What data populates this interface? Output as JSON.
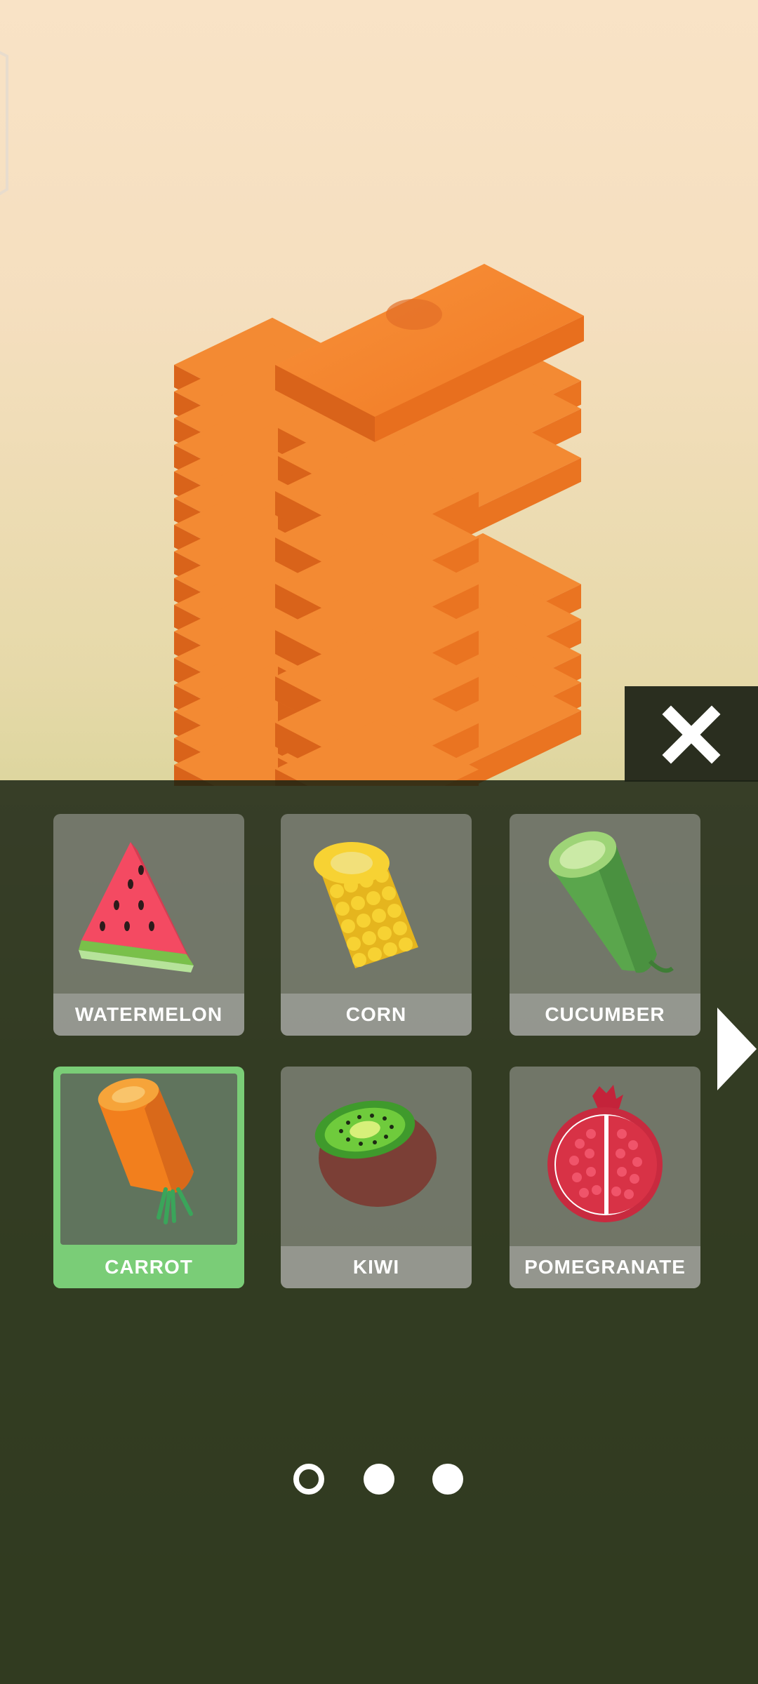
{
  "game": {
    "skins": [
      {
        "label": "WATERMELON",
        "icon": "watermelon-icon",
        "selected": false
      },
      {
        "label": "CORN",
        "icon": "corn-icon",
        "selected": false
      },
      {
        "label": "CUCUMBER",
        "icon": "cucumber-icon",
        "selected": false
      },
      {
        "label": "CARROT",
        "icon": "carrot-icon",
        "selected": true
      },
      {
        "label": "KIWI",
        "icon": "kiwi-icon",
        "selected": false
      },
      {
        "label": "POMEGRANATE",
        "icon": "pomegranate-icon",
        "selected": false
      }
    ],
    "pages": {
      "total": 3,
      "current": 1
    },
    "colors": {
      "tower": "#f07a24",
      "selected_border": "#7acd77",
      "panel": "#192011"
    }
  }
}
